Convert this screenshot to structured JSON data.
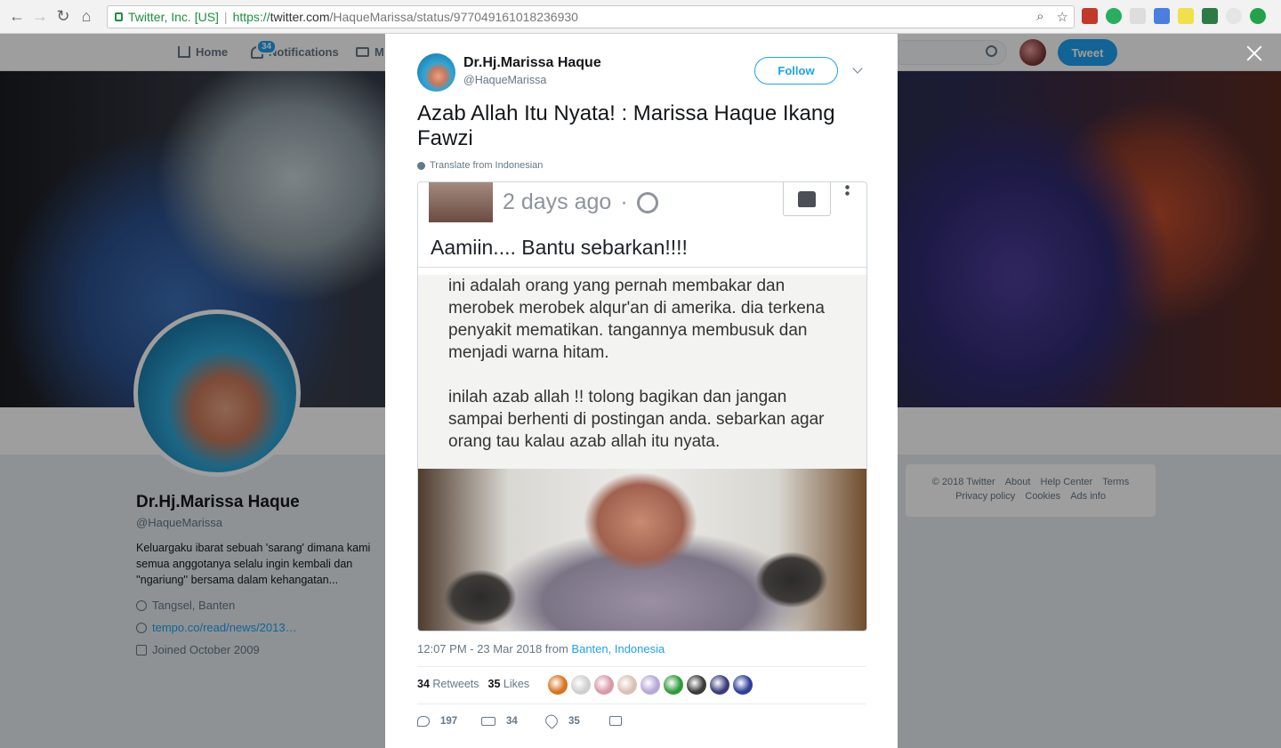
{
  "browser": {
    "site_identity": "Twitter, Inc. [US]",
    "url_scheme": "https://",
    "url_host": "twitter.com",
    "url_path": "/HaqueMarissa/status/977049161018236930"
  },
  "nav": {
    "home": "Home",
    "notifications": "Notifications",
    "notifications_badge": "34",
    "messages": "M",
    "tweet_button": "Tweet"
  },
  "profile": {
    "name": "Dr.Hj.Marissa Haque",
    "handle": "@HaqueMarissa",
    "bio": "Keluargaku ibarat sebuah 'sarang' dimana kami semua anggotanya selalu ingin kembali dan ''ngariung'' bersama dalam kehangatan...",
    "location": "Tangsel, Banten",
    "website": "tempo.co/read/news/2013…",
    "joined": "Joined October 2009"
  },
  "footer": {
    "copyright": "© 2018 Twitter",
    "about": "About",
    "help": "Help Center",
    "terms": "Terms",
    "privacy": "Privacy policy",
    "cookies": "Cookies",
    "ads": "Ads info"
  },
  "tweet": {
    "author_name": "Dr.Hj.Marissa Haque",
    "author_handle": "@HaqueMarissa",
    "follow": "Follow",
    "text": "Azab Allah Itu Nyata! : Marissa Haque Ikang Fawzi",
    "translate": "Translate from Indonesian",
    "timestamp": "12:07 PM - 23 Mar 2018 from ",
    "location": "Banten, Indonesia",
    "retweets_count": "34",
    "retweets_label": "Retweets",
    "likes_count": "35",
    "likes_label": "Likes",
    "replies": "197",
    "retweets": "34",
    "likes": "35"
  },
  "media": {
    "time": "2 days ago",
    "dot": "·",
    "caption": "Aamiin....  Bantu sebarkan!!!!",
    "para1": "ini adalah orang yang pernah membakar dan merobek merobek alqur'an di amerika. dia terkena penyakit mematikan. tangannya membusuk dan menjadi warna hitam.",
    "para2": "inilah azab allah !! tolong bagikan dan jangan sampai berhenti di postingan anda. sebarkan agar orang tau kalau azab allah itu nyata."
  },
  "colors": {
    "accent": "#1da1f2",
    "likers": [
      "#d9731f",
      "#cfcfcf",
      "#d89aa8",
      "#d9c0b5",
      "#b6a7d8",
      "#2e9b3a",
      "#3b3b3b",
      "#3a3d7a",
      "#2c3f9a"
    ]
  }
}
